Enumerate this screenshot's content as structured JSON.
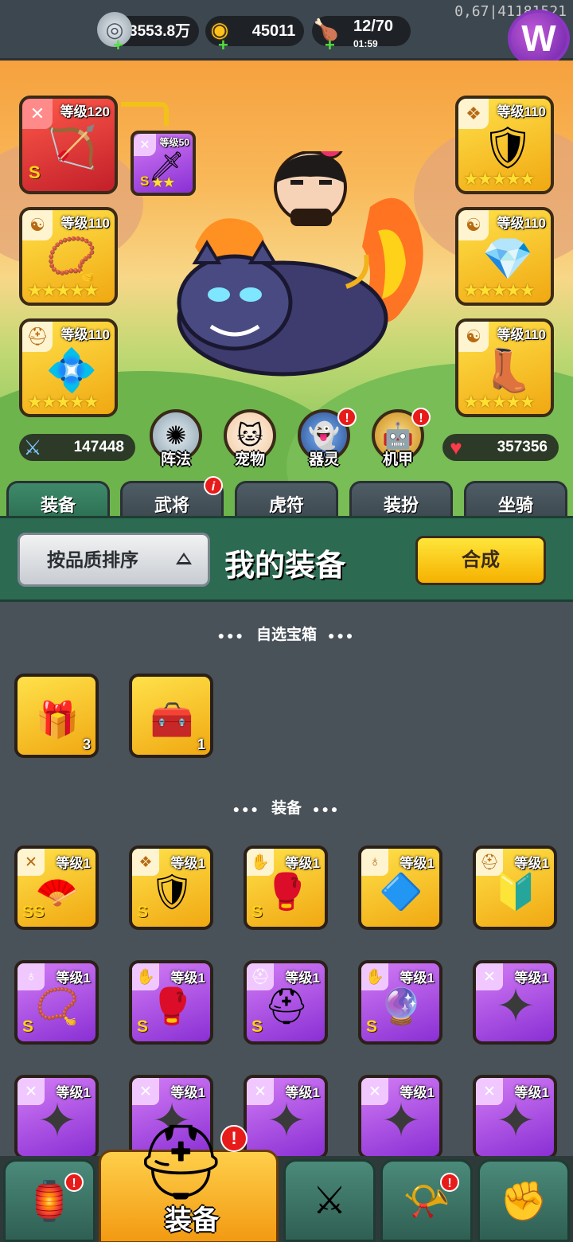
{
  "resources": {
    "silver": {
      "icon": "silver-coin-icon",
      "value": "3553.8万"
    },
    "gold": {
      "icon": "gold-ingot-icon",
      "value": "45011"
    },
    "stamina": {
      "icon": "meat-icon",
      "value": "12/70",
      "timer": "01:59"
    }
  },
  "debug_text": "0,67|41181521",
  "logo_text": "W",
  "equipped": {
    "weapon": {
      "level": "等级120",
      "grade": "S",
      "icon": "crossbow-icon"
    },
    "linked": {
      "level": "等级50",
      "grade": "S",
      "icon": "ice-sword-icon",
      "stars": "★★"
    },
    "amulet": {
      "level": "等级110",
      "icon": "necklace-icon",
      "stars": "★★★★★"
    },
    "helmet": {
      "level": "等级110",
      "icon": "ice-helmet-icon",
      "stars": "★★★★★"
    },
    "armor": {
      "level": "等级110",
      "icon": "armor-icon",
      "stars": "★★★★★"
    },
    "ring": {
      "level": "等级110",
      "icon": "bracer-icon",
      "stars": "★★★★★"
    },
    "boots": {
      "level": "等级110",
      "icon": "boots-icon",
      "stars": "★★★★★"
    }
  },
  "stats": {
    "attack": "147448",
    "hp": "357356"
  },
  "features": [
    {
      "label": "阵法",
      "icon": "formation-icon",
      "alert": false
    },
    {
      "label": "宠物",
      "icon": "cat-icon",
      "alert": false
    },
    {
      "label": "器灵",
      "icon": "spirit-icon",
      "alert": true
    },
    {
      "label": "机甲",
      "icon": "mecha-icon",
      "alert": true
    }
  ],
  "tabs": [
    "装备",
    "武将",
    "虎符",
    "装扮",
    "坐骑"
  ],
  "tab_alert": "i",
  "header": {
    "sort_label": "按品质排序",
    "title": "我的装备",
    "synth_label": "合成"
  },
  "sections": {
    "chests": "自选宝箱",
    "equipment": "装备"
  },
  "chests": [
    {
      "icon": "chest-red-icon",
      "count": "3"
    },
    {
      "icon": "chest-gold-icon",
      "count": "1"
    }
  ],
  "items": [
    {
      "level": "等级1",
      "rarity": "gold",
      "grade": "SS",
      "icon": "weapon-icon",
      "art": "fan-icon"
    },
    {
      "level": "等级1",
      "rarity": "gold",
      "grade": "S",
      "icon": "armor-icon",
      "art": "armor-icon"
    },
    {
      "level": "等级1",
      "rarity": "gold",
      "grade": "S",
      "icon": "glove-icon",
      "art": "gauntlet-icon"
    },
    {
      "level": "等级1",
      "rarity": "gold",
      "grade": "",
      "icon": "amulet-icon",
      "art": "pendant-icon"
    },
    {
      "level": "等级1",
      "rarity": "gold",
      "grade": "",
      "icon": "helmet-icon",
      "art": "shield-icon"
    },
    {
      "level": "等级1",
      "rarity": "purple",
      "grade": "S",
      "icon": "amulet-icon",
      "art": "necklace-icon"
    },
    {
      "level": "等级1",
      "rarity": "purple",
      "grade": "S",
      "icon": "glove-icon",
      "art": "gauntlet-icon"
    },
    {
      "level": "等级1",
      "rarity": "purple",
      "grade": "S",
      "icon": "helmet-icon",
      "art": "helmet-icon"
    },
    {
      "level": "等级1",
      "rarity": "purple",
      "grade": "S",
      "icon": "glove-icon",
      "art": "orb-glove-icon"
    },
    {
      "level": "等级1",
      "rarity": "purple",
      "grade": "",
      "icon": "weapon-icon",
      "art": "shuriken-icon"
    },
    {
      "level": "等级1",
      "rarity": "purple",
      "grade": "",
      "icon": "weapon-icon",
      "art": "shuriken-icon"
    },
    {
      "level": "等级1",
      "rarity": "purple",
      "grade": "",
      "icon": "weapon-icon",
      "art": "shuriken-icon"
    },
    {
      "level": "等级1",
      "rarity": "purple",
      "grade": "",
      "icon": "weapon-icon",
      "art": "shuriken-icon"
    },
    {
      "level": "等级1",
      "rarity": "purple",
      "grade": "",
      "icon": "weapon-icon",
      "art": "shuriken-icon"
    },
    {
      "level": "等级1",
      "rarity": "purple",
      "grade": "",
      "icon": "weapon-icon",
      "art": "shuriken-icon"
    }
  ],
  "nav": [
    {
      "icon": "shop-icon",
      "alert": true
    },
    {
      "icon": "helmet-icon",
      "label": "装备",
      "alert": true,
      "active": true
    },
    {
      "icon": "swords-icon",
      "alert": false
    },
    {
      "icon": "horn-icon",
      "alert": true
    },
    {
      "icon": "upgrade-fist-icon",
      "alert": false
    }
  ],
  "colors": {
    "gold_rarity": "#f0a812",
    "purple_rarity": "#8a2fd4",
    "accent_green": "#2c6a52",
    "synth_yellow": "#f5b100"
  }
}
